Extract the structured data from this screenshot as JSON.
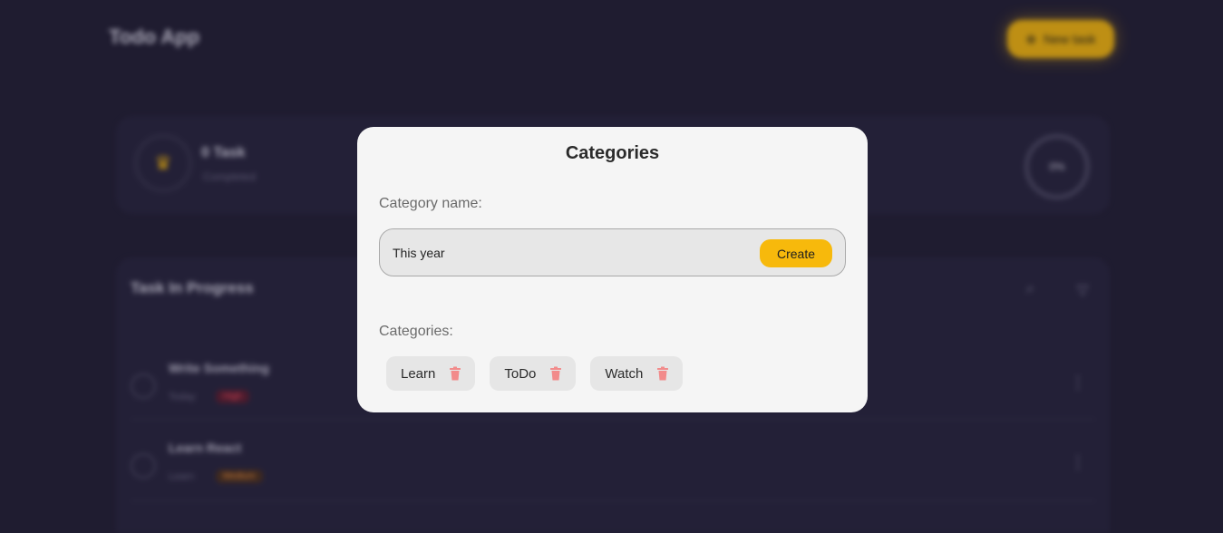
{
  "app": {
    "title": "Todo App",
    "new_task_label": "New task"
  },
  "summary": {
    "count_label": "0 Task",
    "sub_label": "Completed",
    "progress": "0%"
  },
  "tasks": {
    "heading": "Task In Progress",
    "items": [
      {
        "name": "Write Something",
        "date": "Today",
        "tag": "High"
      },
      {
        "name": "Learn React",
        "date": "Learn",
        "tag": "Medium"
      }
    ]
  },
  "modal": {
    "title": "Categories",
    "name_label": "Category name:",
    "input_value": "This year",
    "create_label": "Create",
    "list_label": "Categories:",
    "categories": [
      {
        "label": "Learn",
        "icon": "trash-icon"
      },
      {
        "label": "ToDo",
        "icon": "trash-icon"
      },
      {
        "label": "Watch",
        "icon": "trash-icon"
      }
    ]
  },
  "colors": {
    "accent": "#f7b90c",
    "delete": "#f28b8b",
    "backdrop": "#1f1c30"
  }
}
